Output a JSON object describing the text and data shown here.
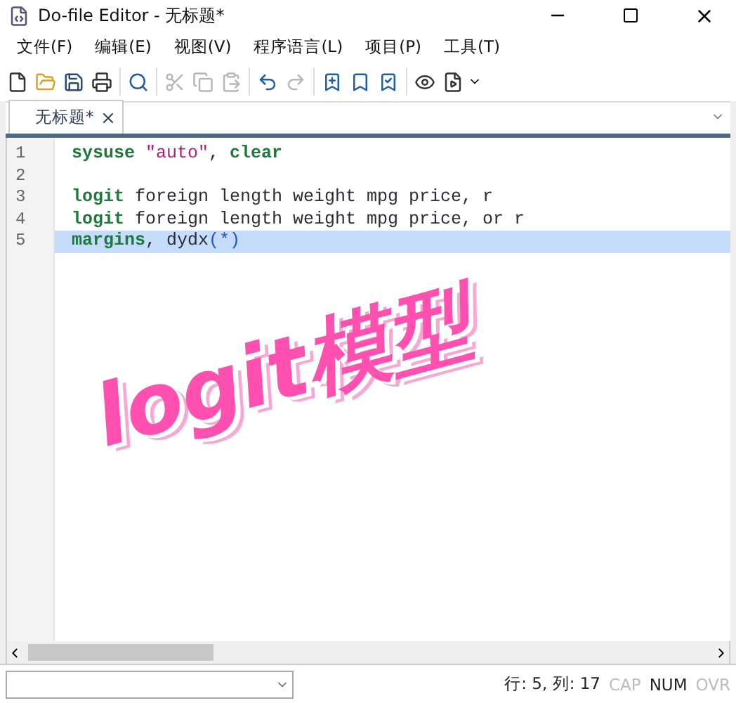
{
  "window": {
    "title": "Do-file Editor - 无标题*"
  },
  "menu": [
    "文件(F)",
    "编辑(E)",
    "视图(V)",
    "程序语言(L)",
    "项目(P)",
    "工具(T)"
  ],
  "toolbar": [
    {
      "kind": "new",
      "disabled": false
    },
    {
      "kind": "open",
      "disabled": false
    },
    {
      "kind": "save",
      "disabled": false
    },
    {
      "kind": "print",
      "disabled": false
    },
    {
      "kind": "sep"
    },
    {
      "kind": "find",
      "disabled": false
    },
    {
      "kind": "sep"
    },
    {
      "kind": "cut",
      "disabled": true
    },
    {
      "kind": "copy",
      "disabled": true
    },
    {
      "kind": "paste",
      "disabled": true
    },
    {
      "kind": "sep"
    },
    {
      "kind": "undo",
      "disabled": false
    },
    {
      "kind": "redo",
      "disabled": true
    },
    {
      "kind": "sep"
    },
    {
      "kind": "bookmark",
      "disabled": false
    },
    {
      "kind": "bookmark-prev",
      "disabled": false
    },
    {
      "kind": "bookmark-next",
      "disabled": false
    },
    {
      "kind": "sep"
    },
    {
      "kind": "preview",
      "disabled": false
    },
    {
      "kind": "run",
      "disabled": false
    }
  ],
  "tabs": [
    {
      "label": "无标题*",
      "selected": true
    }
  ],
  "editor": {
    "lines": [
      {
        "number": "1",
        "selected": false,
        "tokens": [
          {
            "kind": "command",
            "text": "sysuse"
          },
          {
            "kind": "string",
            "text": " \"auto\""
          },
          {
            "kind": "plain",
            "text": ", "
          },
          {
            "kind": "command",
            "text": "clear"
          }
        ]
      },
      {
        "number": "2",
        "selected": false
      },
      {
        "number": "3",
        "selected": false,
        "tokens": [
          {
            "kind": "command",
            "text": "logit"
          },
          {
            "kind": "plain",
            "text": " foreign length weight mpg price, r"
          }
        ]
      },
      {
        "number": "4",
        "selected": false,
        "tokens": [
          {
            "kind": "command",
            "text": "logit"
          },
          {
            "kind": "plain",
            "text": " foreign length weight mpg price, or r"
          }
        ]
      },
      {
        "number": "5",
        "selected": true,
        "tokens": [
          {
            "kind": "command",
            "text": "margins"
          },
          {
            "kind": "plain",
            "text": ", dydx"
          },
          {
            "kind": "operator",
            "text": "(*)"
          }
        ]
      }
    ]
  },
  "overlay_text": "logit模型",
  "status_bar": {
    "position": "行: 5, 列: 17",
    "indicators": [
      {
        "label": "CAP",
        "on": false
      },
      {
        "label": "NUM",
        "on": true
      },
      {
        "label": "OVR",
        "on": false
      }
    ]
  }
}
